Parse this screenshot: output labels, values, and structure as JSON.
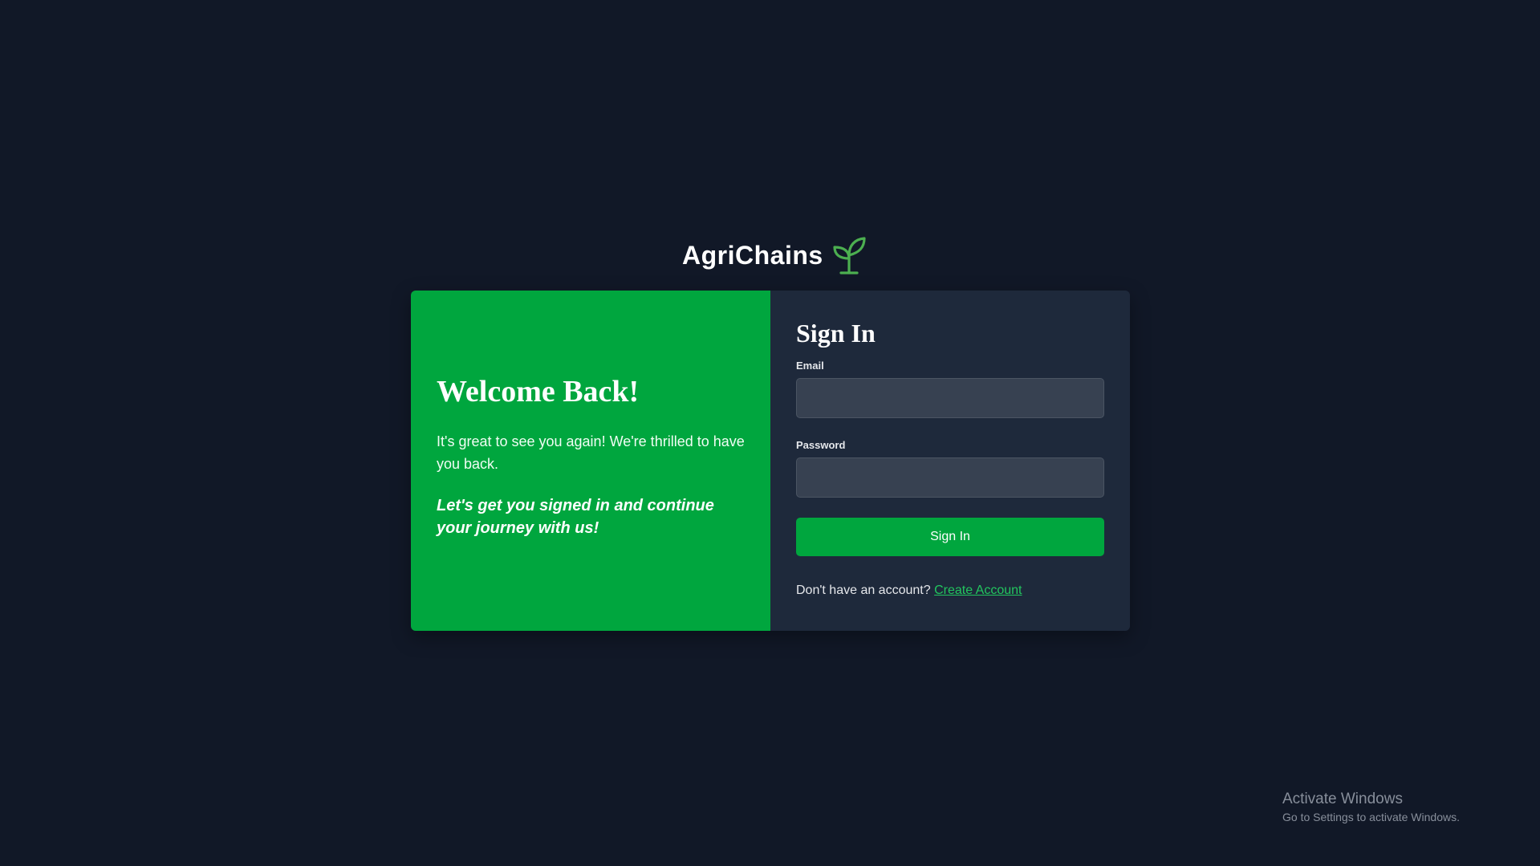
{
  "brand": {
    "name": "AgriChains",
    "logo_icon": "seedling-icon",
    "logo_color": "#4caf50"
  },
  "welcome": {
    "title": "Welcome Back!",
    "text": "It's great to see you again! We're thrilled to have you back.",
    "emphasis": "Let's get you signed in and continue your journey with us!"
  },
  "signin": {
    "title": "Sign In",
    "email_label": "Email",
    "email_value": "",
    "password_label": "Password",
    "password_value": "",
    "button_label": "Sign In",
    "no_account_text": "Don't have an account?",
    "create_account_label": "Create Account"
  },
  "watermark": {
    "title": "Activate Windows",
    "subtitle": "Go to Settings to activate Windows."
  },
  "colors": {
    "background": "#111827",
    "accent": "#00a63e",
    "panel": "#1e293b",
    "link": "#22c55e"
  }
}
